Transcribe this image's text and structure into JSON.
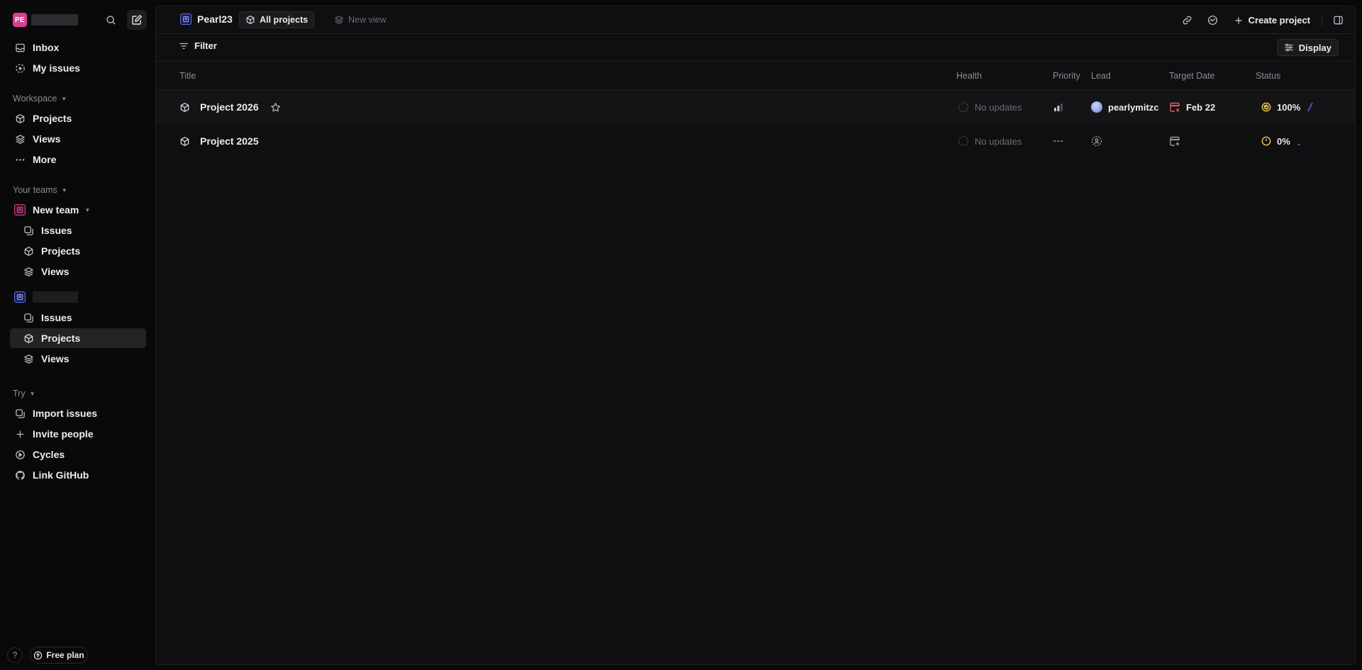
{
  "workspace": {
    "initials": "PE",
    "accent": "#d6408e"
  },
  "sidebar": {
    "primary": [
      {
        "label": "Inbox",
        "icon": "inbox-icon"
      },
      {
        "label": "My issues",
        "icon": "my-issues-icon"
      }
    ],
    "workspace_label": "Workspace",
    "workspace_items": [
      {
        "label": "Projects",
        "icon": "cube-icon"
      },
      {
        "label": "Views",
        "icon": "layers-icon"
      },
      {
        "label": "More",
        "icon": "ellipsis-icon"
      }
    ],
    "teams_label": "Your teams",
    "team1": {
      "name": "New team",
      "color": "#d6408e",
      "items": [
        {
          "label": "Issues",
          "icon": "issues-icon"
        },
        {
          "label": "Projects",
          "icon": "cube-icon"
        },
        {
          "label": "Views",
          "icon": "layers-icon"
        }
      ]
    },
    "team2": {
      "color": "#5b6ee8",
      "items": [
        {
          "label": "Issues",
          "icon": "issues-icon"
        },
        {
          "label": "Projects",
          "icon": "cube-icon",
          "active": true
        },
        {
          "label": "Views",
          "icon": "layers-icon"
        }
      ]
    },
    "try_label": "Try",
    "try_items": [
      {
        "label": "Import issues",
        "icon": "import-icon"
      },
      {
        "label": "Invite people",
        "icon": "plus-icon"
      },
      {
        "label": "Cycles",
        "icon": "cycles-icon"
      },
      {
        "label": "Link GitHub",
        "icon": "github-icon"
      }
    ],
    "help_label": "?",
    "free_plan_label": "Free plan"
  },
  "topbar": {
    "team_name": "Pearl23",
    "tab_all": "All projects",
    "tab_new": "New view",
    "create_label": "Create project"
  },
  "toolbar": {
    "filter_label": "Filter",
    "display_label": "Display"
  },
  "table": {
    "columns": [
      "Title",
      "Health",
      "Priority",
      "Lead",
      "Target Date",
      "Status"
    ],
    "rows": [
      {
        "title": "Project 2026",
        "health": "No updates",
        "priority": "medium",
        "lead": "pearlymitzc",
        "target_date": "Feb 22",
        "target_overdue": true,
        "status": "100%",
        "progress": 1.0
      },
      {
        "title": "Project 2025",
        "health": "No updates",
        "priority": "none",
        "lead": "",
        "target_date": "",
        "target_overdue": false,
        "status": "0%",
        "progress": 0.0
      }
    ]
  },
  "colors": {
    "overdue": "#eb5757",
    "status_ring": "#f2c94c",
    "progress_line": "#5b6ee8"
  }
}
